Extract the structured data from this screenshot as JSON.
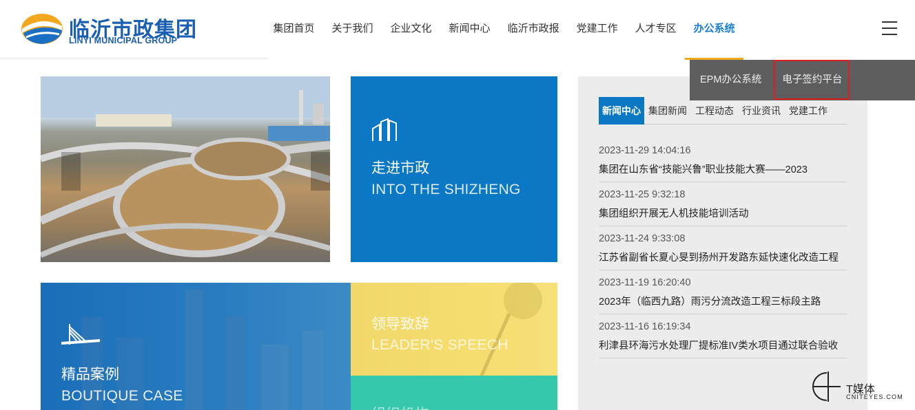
{
  "logo": {
    "cn": "临沂市政集团",
    "en": "LINYI MUNICIPAL GROUP"
  },
  "nav": {
    "items": [
      {
        "label": "集团首页"
      },
      {
        "label": "关于我们"
      },
      {
        "label": "企业文化"
      },
      {
        "label": "新闻中心"
      },
      {
        "label": "临沂市政报"
      },
      {
        "label": "党建工作"
      },
      {
        "label": "人才专区"
      },
      {
        "label": "办公系统",
        "active": true
      }
    ]
  },
  "dropdown": {
    "items": [
      {
        "label": "EPM办公系统"
      },
      {
        "label": "电子签约平台"
      }
    ]
  },
  "tiles": {
    "about": {
      "cn": "走进市政",
      "en": "INTO THE SHIZHENG"
    },
    "case": {
      "cn": "精品案例",
      "en": "BOUTIQUE CASE"
    },
    "speech": {
      "cn": "领导致辞",
      "en": "LEADER'S SPEECH"
    },
    "org": {
      "cn": "组织机构"
    }
  },
  "news": {
    "tabs": [
      {
        "label": "新闻中心",
        "active": true
      },
      {
        "label": "集团新闻"
      },
      {
        "label": "工程动态"
      },
      {
        "label": "行业资讯"
      },
      {
        "label": "党建工作"
      }
    ],
    "items": [
      {
        "date": "2023-11-29 14:04:16",
        "title": "集团在山东省“技能兴鲁”职业技能大赛——2023"
      },
      {
        "date": "2023-11-25 9:32:18",
        "title": "集团组织开展无人机技能培训活动"
      },
      {
        "date": "2023-11-24 9:33:08",
        "title": "江苏省副省长夏心旻到扬州开发路东延快速化改造工程"
      },
      {
        "date": "2023-11-19 16:20:40",
        "title": "2023年（临西九路）雨污分流改造工程三标段主路"
      },
      {
        "date": "2023-11-16 16:19:34",
        "title": "利津县环海污水处理厂提标准IV类水项目通过联合验收"
      }
    ]
  },
  "watermark": {
    "cn": "T媒体",
    "en": "CNITEYES.COM"
  },
  "colors": {
    "brand": "#1a5fb4",
    "accent": "#0b78c5",
    "nav_underline": "#f2a81d",
    "highlight": "#e02020"
  }
}
